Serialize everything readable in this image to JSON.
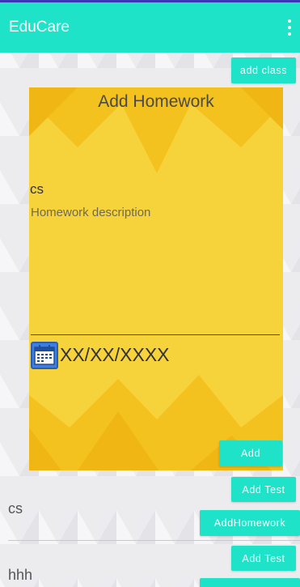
{
  "appbar": {
    "title": "EduCare",
    "menu_icon": "more-vert-icon"
  },
  "toolbar": {
    "add_class_label": "add class"
  },
  "dialog": {
    "title": "Add Homework",
    "class_name": "cs",
    "description_placeholder": "Homework description",
    "date_value": "XX/XX/XXXX",
    "date_icon": "calendar-icon",
    "add_label": "Add"
  },
  "classes": [
    {
      "name": "cs",
      "add_test_label": "Add Test",
      "add_homework_label": "AddHomework"
    },
    {
      "name": "hhh",
      "add_test_label": "Add Test"
    }
  ],
  "colors": {
    "accent": "#1fe3c9",
    "dialog_bg": "#f7d33b",
    "top_line": "#3b36b5"
  }
}
